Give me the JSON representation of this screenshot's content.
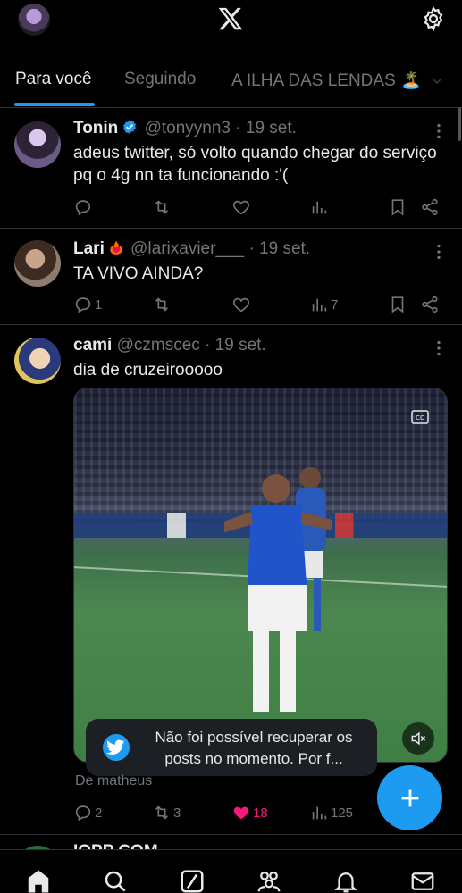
{
  "header": {
    "avatar_icon": "profile-avatar",
    "logo_icon": "x-logo-icon",
    "settings_icon": "gear-icon"
  },
  "tabs": [
    {
      "label": "Para você",
      "active": true
    },
    {
      "label": "Seguindo",
      "active": false
    },
    {
      "label": "A ILHA DAS LENDAS 🏝️",
      "active": false
    }
  ],
  "tweets": [
    {
      "name": "Tonin",
      "verified": true,
      "handle": "@tonyynn3",
      "date": "19 set.",
      "text": "adeus twitter, só volto quando chegar do serviço pq o 4g nn ta funcionando :'(",
      "replies": "",
      "retweets": "",
      "likes": "",
      "views": ""
    },
    {
      "name": "Lari",
      "handle": "@larixavier___",
      "date": "19 set.",
      "text": "TA VIVO AINDA?",
      "replies": "1",
      "retweets": "",
      "likes": "",
      "views": "7"
    },
    {
      "name": "cami",
      "handle": "@czmscec",
      "date": "19 set.",
      "text": "dia de cruzeirooooo",
      "media_from": "De matheus",
      "replies": "2",
      "retweets": "3",
      "likes": "18",
      "liked": true,
      "views": "125"
    }
  ],
  "toast": {
    "text": "Não foi possível recuperar os posts no momento. Por f..."
  },
  "colors": {
    "accent": "#1d9bf0",
    "like": "#f91880",
    "muted": "#71767b",
    "divider": "#2f3336"
  },
  "next_tweet_peek": "IOPP COM",
  "bottom_nav": [
    "home-icon",
    "search-icon",
    "grok-icon",
    "communities-icon",
    "notifications-icon",
    "messages-icon"
  ]
}
